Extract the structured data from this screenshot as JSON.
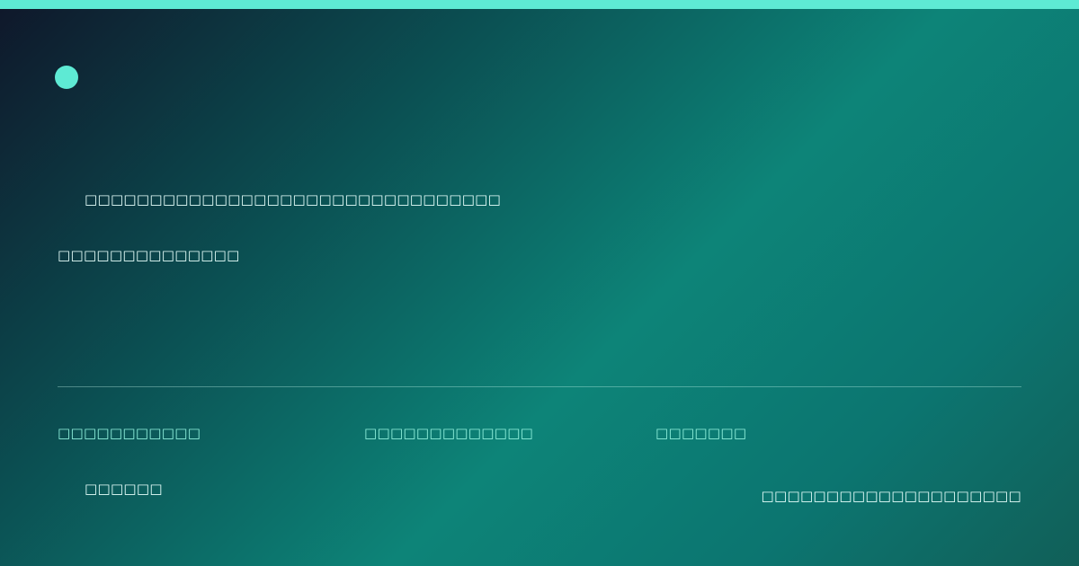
{
  "headline": "□□□□□□□□□□□□□□□□□□□□□□□□□□□□□□□□",
  "subline": "□□□□□□□□□□□□□□",
  "stats": [
    "□□□□□□□□□□□",
    "□□□□□□□□□□□□□",
    "□□□□□□□"
  ],
  "footer": {
    "brand": "□□□□□□",
    "site": "□□□□□□□□□□□□□□□□□□□□"
  },
  "colors": {
    "accent": "#5eead4",
    "gradient_start": "#0f172a",
    "gradient_mid": "#0d8478",
    "gradient_end": "#115f58"
  }
}
